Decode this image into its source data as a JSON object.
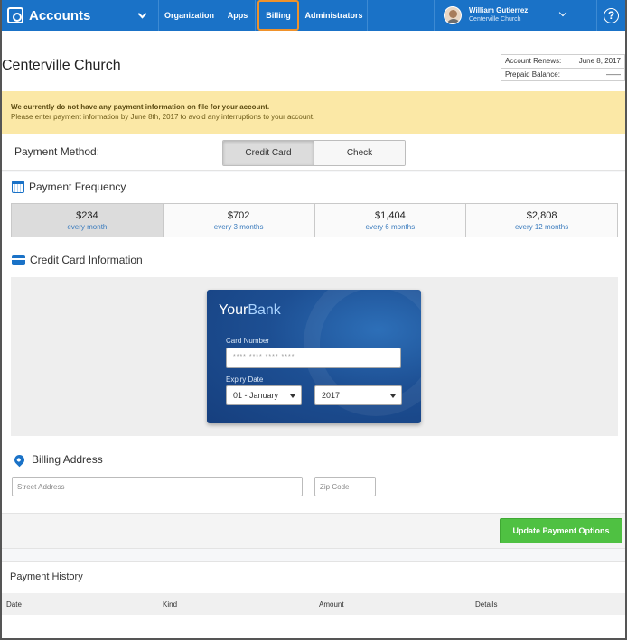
{
  "nav": {
    "brand": "Accounts",
    "links": [
      "Organization",
      "Apps",
      "Billing",
      "Administrators"
    ],
    "user_name": "William Gutierrez",
    "user_org": "Centerville Church",
    "help": "?"
  },
  "header": {
    "title": "Centerville Church",
    "renews_label": "Account Renews:",
    "renews_value": "June 8, 2017",
    "prepaid_label": "Prepaid Balance:",
    "prepaid_value": "——"
  },
  "alert": {
    "line1": "We currently do not have any payment information on file for your account.",
    "line2": "Please enter payment information by June 8th, 2017 to avoid any interruptions to your account."
  },
  "payment_method": {
    "label": "Payment Method:",
    "options": [
      "Credit Card",
      "Check"
    ],
    "selected": "Credit Card"
  },
  "frequency": {
    "title": "Payment Frequency",
    "options": [
      {
        "amount": "$234",
        "period": "every month"
      },
      {
        "amount": "$702",
        "period": "every 3 months"
      },
      {
        "amount": "$1,404",
        "period": "every 6 months"
      },
      {
        "amount": "$2,808",
        "period": "every 12 months"
      }
    ],
    "selected": "$234"
  },
  "card": {
    "title": "Credit Card Information",
    "bank_name_a": "Your",
    "bank_name_b": "Bank",
    "number_label": "Card Number",
    "number_placeholder": "**** **** **** ****",
    "expiry_label": "Expiry Date",
    "month": "01 - January",
    "year": "2017"
  },
  "address": {
    "title": "Billing Address",
    "street_placeholder": "Street Address",
    "zip_placeholder": "Zip Code"
  },
  "actions": {
    "update": "Update Payment Options"
  },
  "history": {
    "title": "Payment History",
    "columns": [
      "Date",
      "Kind",
      "Amount",
      "Details"
    ]
  },
  "colors": {
    "nav_blue": "#1a72c7",
    "alert_bg": "#fbe8a6",
    "update_green": "#4fc142",
    "billing_highlight": "#f0922b"
  }
}
